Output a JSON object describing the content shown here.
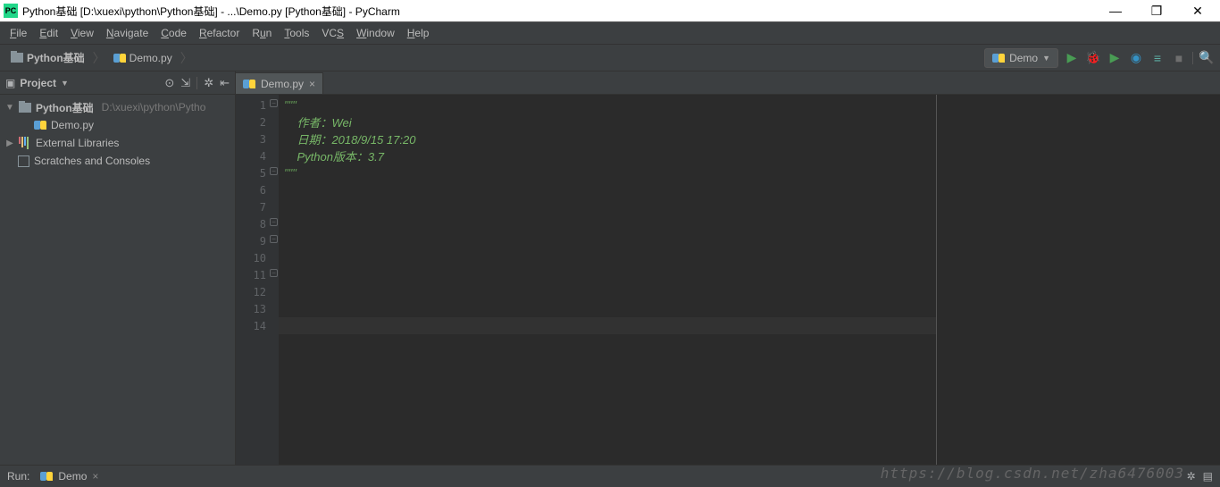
{
  "window": {
    "title": "Python基础 [D:\\xuexi\\python\\Python基础] - ...\\Demo.py [Python基础] - PyCharm"
  },
  "menu": {
    "items": [
      "File",
      "Edit",
      "View",
      "Navigate",
      "Code",
      "Refactor",
      "Run",
      "Tools",
      "VCS",
      "Window",
      "Help"
    ]
  },
  "breadcrumbs": {
    "root": "Python基础",
    "file": "Demo.py"
  },
  "run_config": {
    "label": "Demo"
  },
  "project": {
    "title": "Project",
    "root": {
      "name": "Python基础",
      "path": "D:\\xuexi\\python\\Pytho"
    },
    "file1": "Demo.py",
    "ext_lib": "External Libraries",
    "scratches": "Scratches and Consoles"
  },
  "tabs": [
    {
      "label": "Demo.py"
    }
  ],
  "code": {
    "lines": [
      "\"\"\"",
      "作者：Wei",
      "日期：2018/9/15 17:20",
      "Python版本：3.7",
      "\"\"\"",
      "",
      "",
      "",
      "",
      "",
      "",
      "",
      "",
      ""
    ]
  },
  "bottom": {
    "run": "Run:",
    "run_label": "Demo"
  },
  "watermark": "https://blog.csdn.net/zha6476003"
}
